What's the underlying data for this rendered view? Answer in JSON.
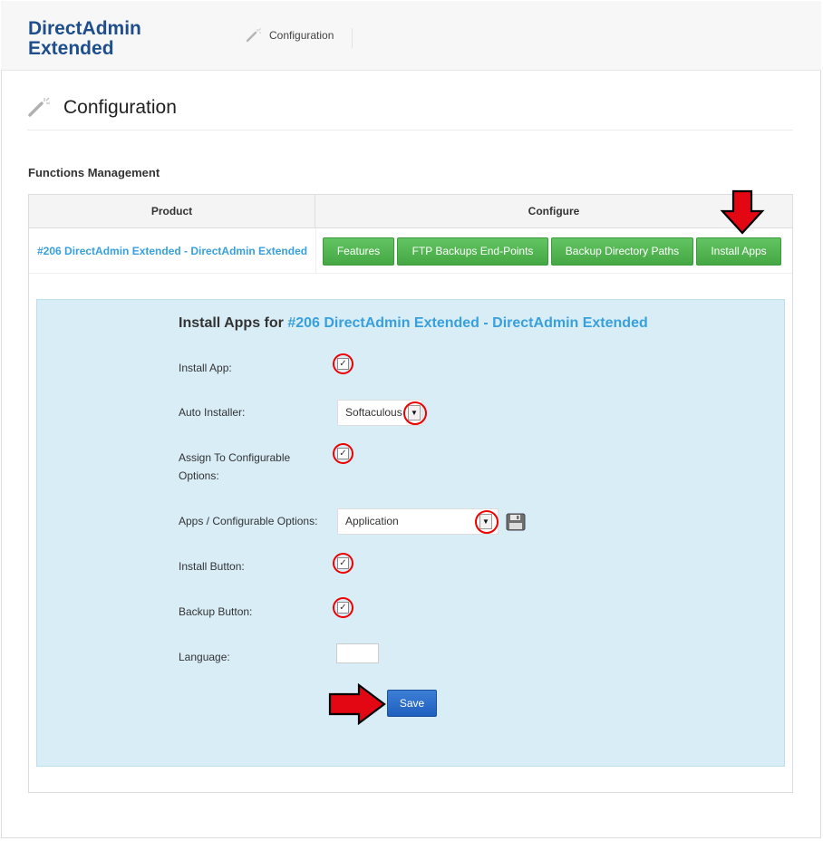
{
  "header": {
    "brand": "DirectAdmin Extended",
    "breadcrumb": "Configuration"
  },
  "page": {
    "title": "Configuration",
    "section_title": "Functions Management"
  },
  "table": {
    "columns": [
      "Product",
      "Configure"
    ],
    "product_link": "#206 DirectAdmin Extended - DirectAdmin Extended",
    "buttons": [
      "Features",
      "FTP Backups End-Points",
      "Backup Directory Paths",
      "Install Apps"
    ]
  },
  "form": {
    "title_prefix": "Install Apps for ",
    "title_product": "#206 DirectAdmin Extended - DirectAdmin Extended",
    "fields": {
      "install_app": {
        "label": "Install App:",
        "checked": true
      },
      "auto_installer": {
        "label": "Auto Installer:",
        "value": "Softaculous"
      },
      "assign_configurable": {
        "label": "Assign To Configurable Options:",
        "checked": true
      },
      "apps_options": {
        "label": "Apps / Configurable Options:",
        "value": "Application"
      },
      "install_button": {
        "label": "Install Button:",
        "checked": true
      },
      "backup_button": {
        "label": "Backup Button:",
        "checked": true
      },
      "language": {
        "label": "Language:",
        "value": ""
      }
    },
    "save_label": "Save"
  },
  "icons": {
    "wand": "magic-wand-icon",
    "save_options": "floppy-disk-icon",
    "arrow_down": "red-arrow-down-icon",
    "arrow_right": "red-arrow-right-icon"
  },
  "colors": {
    "brand": "#1f4e8c",
    "link": "#37a0dd",
    "green_button": "#5cb85c",
    "save_button": "#2a6dc9",
    "form_background": "#d9edf7",
    "highlight": "#e00000"
  }
}
